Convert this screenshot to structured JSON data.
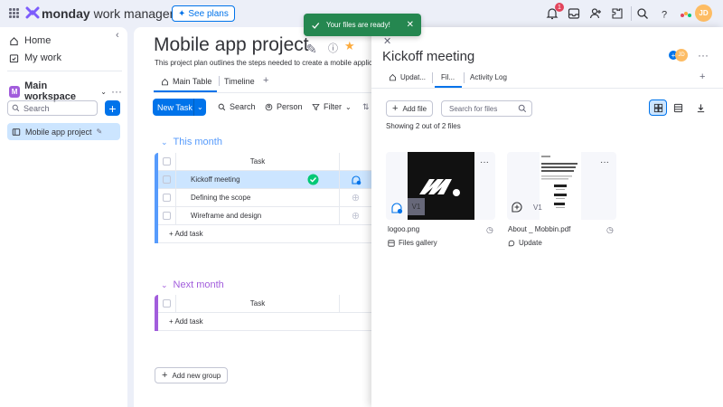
{
  "topbar": {
    "brand_bold": "monday",
    "brand_rest": " work management",
    "see_plans": "See plans",
    "notification_count": "1",
    "user_initials": "JD",
    "icons": [
      "notifications-icon",
      "inbox-icon",
      "invite-icon",
      "apps-marketplace-icon",
      "search-icon",
      "help-icon",
      "monday-products-icon"
    ]
  },
  "sidebar": {
    "home": "Home",
    "my_work": "My work",
    "workspace_initial": "M",
    "workspace_name": "Main workspace",
    "search_placeholder": "Search",
    "board_item": "Mobile app project"
  },
  "board": {
    "title": "Mobile app project",
    "description": "This project plan outlines the steps needed to create a mobile applica",
    "tabs": [
      {
        "label": "Main Table"
      },
      {
        "label": "Timeline"
      }
    ],
    "toolbar": {
      "new_task": "New Task",
      "search": "Search",
      "person": "Person",
      "filter": "Filter"
    },
    "groups": [
      {
        "title": "This month",
        "color": "#579bfc",
        "column_header": "Task",
        "rows": [
          "Kickoff meeting",
          "Defining the scope",
          "Wireframe and design"
        ],
        "add_label": "+ Add task"
      },
      {
        "title": "Next month",
        "color": "#a25ddc",
        "column_header": "Task",
        "rows": [],
        "add_label": "+ Add task"
      }
    ],
    "add_group": "Add new group"
  },
  "toast": {
    "message": "Your files are ready!",
    "color": "#258750"
  },
  "panel": {
    "title": "Kickoff meeting",
    "tabs": [
      {
        "label": "Updat..."
      },
      {
        "label": "Fil..."
      },
      {
        "label": "Activity Log"
      }
    ],
    "add_file": "Add file",
    "search_placeholder": "Search for files",
    "count_text": "Showing 2 out of 2 files",
    "files": [
      {
        "name": "logoo.png",
        "source": "Files gallery",
        "version": "V1"
      },
      {
        "name": "About _ Mobbin.pdf",
        "source": "Update",
        "version": "V1"
      }
    ]
  },
  "colors": {
    "accent": "#0073ea",
    "selected": "#cce5ff",
    "success": "#258750"
  }
}
